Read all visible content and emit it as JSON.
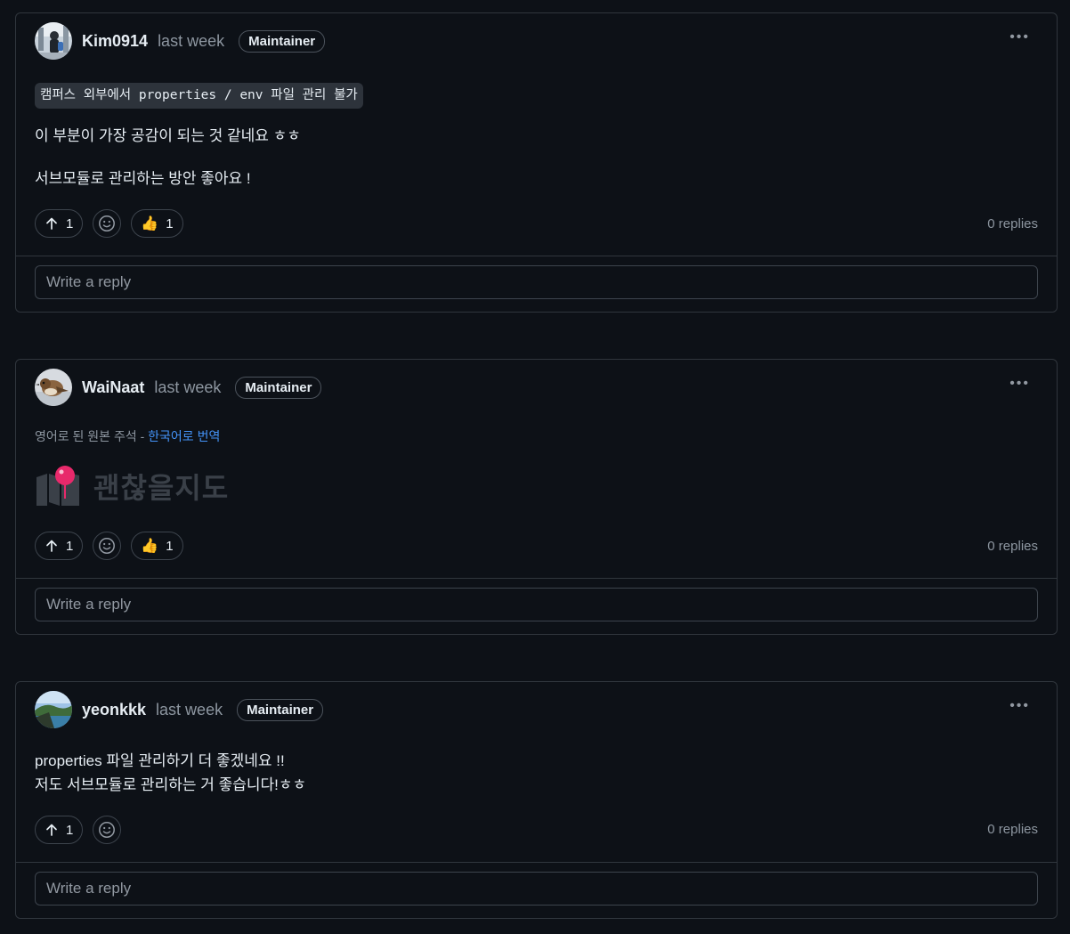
{
  "comments": [
    {
      "author": "Kim0914",
      "time": "last week",
      "badge": "Maintainer",
      "code_text": "캠퍼스 외부에서 properties / env 파일 관리 불가",
      "line1": "이 부분이 가장 공감이 되는 것 같네요 ㅎㅎ",
      "line2": "서브모듈로 관리하는 방안 좋아요 !",
      "upvotes": "1",
      "thumbs": "1",
      "replies": "0 replies",
      "reply_placeholder": "Write a reply"
    },
    {
      "author": "WaiNaat",
      "time": "last week",
      "badge": "Maintainer",
      "translate_prefix": "영어로 된 원본 주석 - ",
      "translate_link": "한국어로 번역",
      "logo_text": "괜찮을지도",
      "upvotes": "1",
      "thumbs": "1",
      "replies": "0 replies",
      "reply_placeholder": "Write a reply"
    },
    {
      "author": "yeonkkk",
      "time": "last week",
      "badge": "Maintainer",
      "line1": "properties 파일 관리하기 더 좋겠네요 !!",
      "line2": "저도 서브모듈로 관리하는 거 좋습니다!ㅎㅎ",
      "upvotes": "1",
      "replies": "0 replies",
      "reply_placeholder": "Write a reply"
    }
  ],
  "icons": {
    "more": "kebab-horizontal-icon",
    "upvote": "arrow-up-icon",
    "emoji": "smiley-icon",
    "thumbs": "thumbs-up-emoji"
  },
  "colors": {
    "background": "#0d1117",
    "border": "#30363d",
    "link": "#4493f8",
    "muted": "#8d96a0",
    "logo_pin": "#e8296b"
  }
}
